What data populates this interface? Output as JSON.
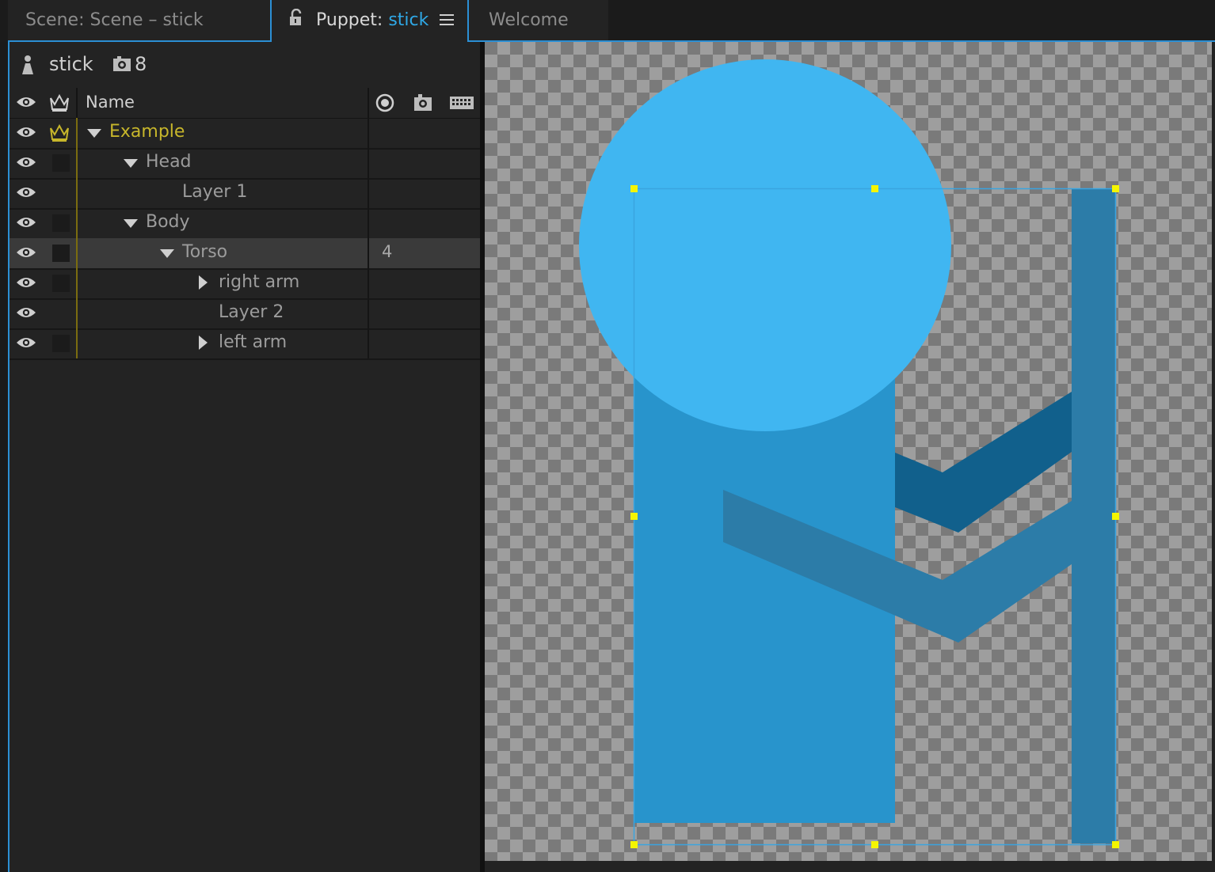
{
  "tabs": {
    "scene": "Scene: Scene – stick",
    "puppet_prefix": "Puppet: ",
    "puppet_name": "stick",
    "welcome": "Welcome"
  },
  "puppet_info": {
    "name": "stick",
    "camera_count": "8"
  },
  "layers_header": {
    "name": "Name"
  },
  "layers": [
    {
      "label": "Example",
      "count": "",
      "expander": "down",
      "crown": true,
      "box": false,
      "selected": false
    },
    {
      "label": "Head",
      "count": "",
      "expander": "down",
      "crown": false,
      "box": true,
      "selected": false
    },
    {
      "label": "Layer 1",
      "count": "",
      "expander": "none",
      "crown": false,
      "box": false,
      "selected": false
    },
    {
      "label": "Body",
      "count": "",
      "expander": "down",
      "crown": false,
      "box": true,
      "selected": false
    },
    {
      "label": "Torso",
      "count": "4",
      "expander": "down",
      "crown": false,
      "box": true,
      "selected": true
    },
    {
      "label": "right arm",
      "count": "",
      "expander": "right",
      "crown": false,
      "box": true,
      "selected": false
    },
    {
      "label": "Layer 2",
      "count": "",
      "expander": "none",
      "crown": false,
      "box": false,
      "selected": false
    },
    {
      "label": "left arm",
      "count": "",
      "expander": "right",
      "crown": false,
      "box": true,
      "selected": false
    }
  ],
  "colors": {
    "accent": "#2b8fd4",
    "gold": "#c7b62b",
    "head": "#40b6f1",
    "torso": "#2894cc",
    "arm_dark": "#11608c",
    "arm_mid": "#2c7ca8",
    "handle": "#f5f500"
  }
}
